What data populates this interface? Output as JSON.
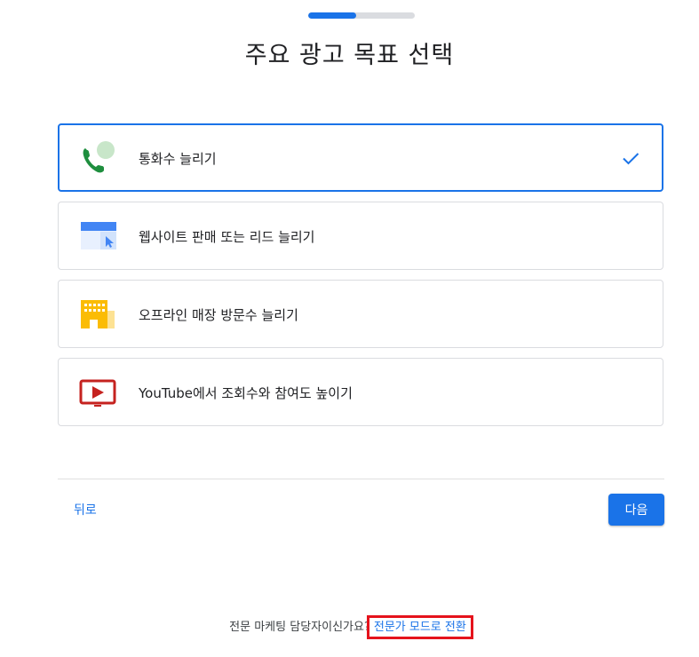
{
  "progress": {
    "fraction": 0.45,
    "track_color": "#dadce0",
    "fill_color": "#1a73e8"
  },
  "page_title": "주요 광고 목표 선택",
  "options": [
    {
      "label": "통화수 늘리기",
      "icon": "phone-call-icon",
      "selected": true
    },
    {
      "label": "웹사이트 판매 또는 리드 늘리기",
      "icon": "website-cursor-icon",
      "selected": false
    },
    {
      "label": "오프라인 매장 방문수 늘리기",
      "icon": "storefront-icon",
      "selected": false
    },
    {
      "label": "YouTube에서 조회수와 참여도 높이기",
      "icon": "youtube-play-icon",
      "selected": false
    }
  ],
  "actions": {
    "back_label": "뒤로",
    "next_label": "다음"
  },
  "footer": {
    "question": "전문 마케팅 담당자이신가요?",
    "link_label": "전문가 모드로 전환",
    "highlight_color": "#e5131c"
  },
  "colors": {
    "accent": "#1a73e8",
    "border": "#dadce0"
  }
}
